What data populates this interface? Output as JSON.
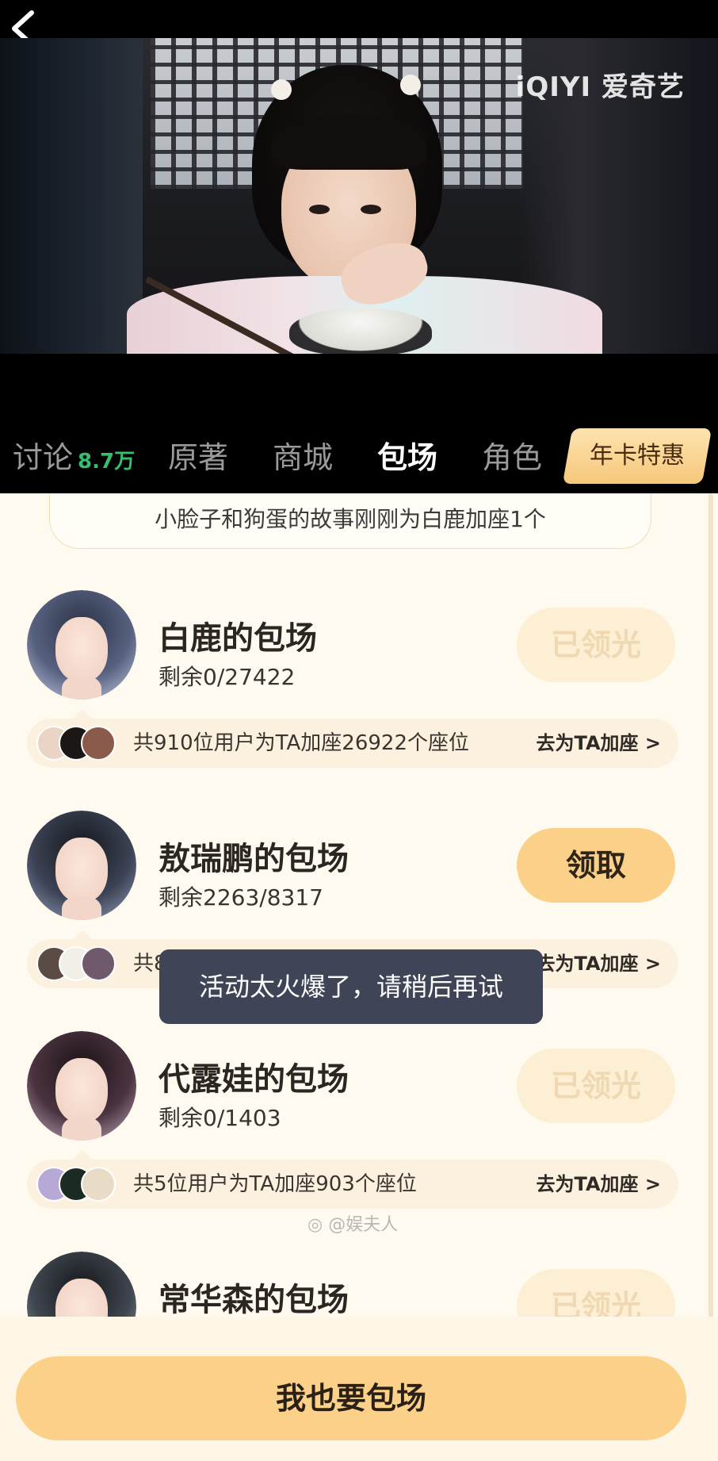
{
  "video": {
    "logo_text": "iQIYI 爱奇艺"
  },
  "tabs": {
    "discussion": "讨论",
    "discussion_count": "8.7万",
    "original": "原著",
    "mall": "商城",
    "booking": "包场",
    "roles": "角色",
    "promo": "年卡特惠"
  },
  "notice": "小脸子和狗蛋的故事刚刚为白鹿加座1个",
  "cards": [
    {
      "title": "白鹿的包场",
      "remain": "剩余0/27422",
      "button": "已领光",
      "fans_text": "共910位用户为TA加座26922个座位",
      "link": "去为TA加座 >"
    },
    {
      "title": "敖瑞鹏的包场",
      "remain": "剩余2263/8317",
      "button": "领取",
      "fans_text": "共87位用户为TA加座7817个座位",
      "link": "去为TA加座 >"
    },
    {
      "title": "代露娃的包场",
      "remain": "剩余0/1403",
      "button": "已领光",
      "fans_text": "共5位用户为TA加座903个座位",
      "link": "去为TA加座 >"
    },
    {
      "title": "常华森的包场",
      "button": "已领光"
    }
  ],
  "toast": "活动太火爆了，请稍后再试",
  "weibo_watermark": "@娱夫人",
  "cta": "我也要包场"
}
